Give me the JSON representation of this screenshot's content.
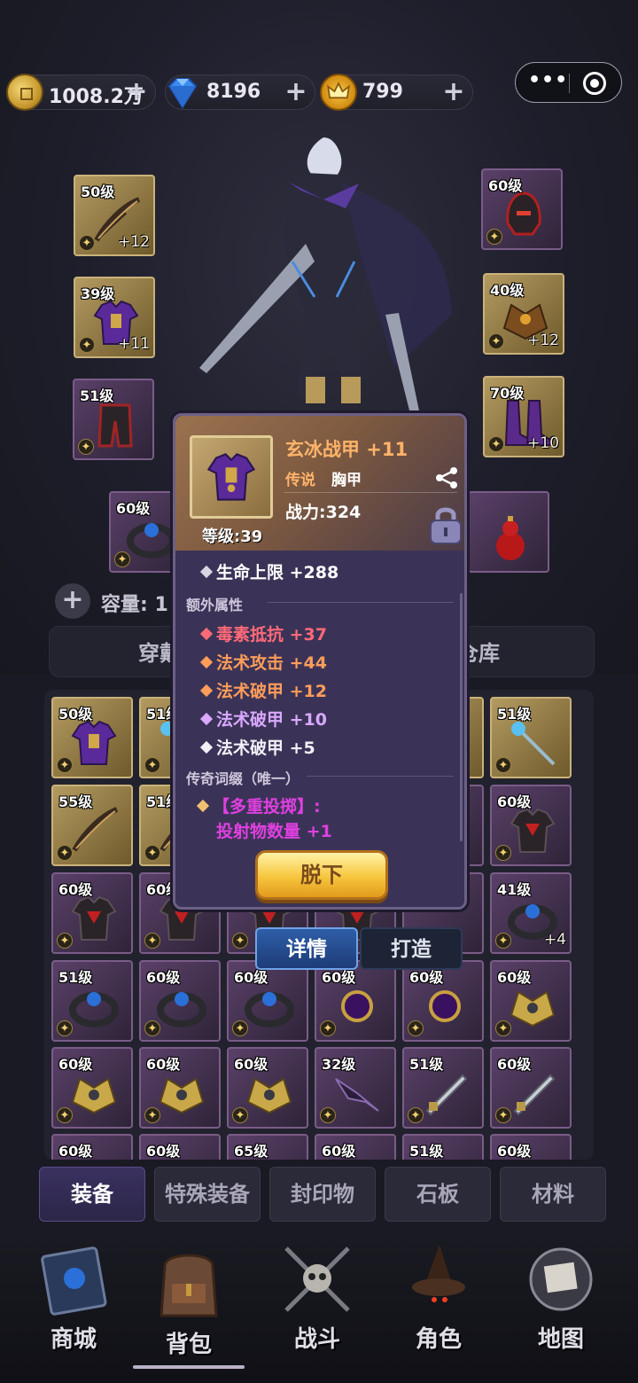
{
  "currency": {
    "gold": "1008.2万",
    "diamonds": "8196",
    "crowns": "799",
    "plus_symbol": "+"
  },
  "capsule": {
    "more_label": "•••"
  },
  "equipped_slots": [
    {
      "level": "50级",
      "enhance": "+12",
      "frame": "gold",
      "item": "bow"
    },
    {
      "level": "39级",
      "enhance": "+11",
      "frame": "gold",
      "item": "chest-armor"
    },
    {
      "level": "51级",
      "enhance": "",
      "frame": "purple",
      "item": "pants"
    },
    {
      "level": "60级",
      "enhance": "",
      "frame": "purple",
      "item": "ring"
    },
    {
      "level": "60级",
      "enhance": "",
      "frame": "purple",
      "item": "helmet"
    },
    {
      "level": "40级",
      "enhance": "+12",
      "frame": "gold",
      "item": "shoulder"
    },
    {
      "level": "70级",
      "enhance": "+10",
      "frame": "gold",
      "item": "boots"
    },
    {
      "level": "",
      "enhance": "",
      "frame": "purple",
      "item": "gourd"
    }
  ],
  "capacity": {
    "label": "容量: 11"
  },
  "subtabs": {
    "left": "穿戴",
    "right": "仓库"
  },
  "inventory": [
    {
      "level": "50级",
      "enhance": "",
      "frame": "gold",
      "item": "chest-armor"
    },
    {
      "level": "51级",
      "enhance": "",
      "frame": "gold",
      "item": "staff"
    },
    {
      "level": "",
      "enhance": "",
      "frame": "gold",
      "item": "none"
    },
    {
      "level": "",
      "enhance": "",
      "frame": "gold",
      "item": "none"
    },
    {
      "level": "",
      "enhance": "",
      "frame": "gold",
      "item": "none"
    },
    {
      "level": "51级",
      "enhance": "",
      "frame": "gold",
      "item": "staff"
    },
    {
      "level": "55级",
      "enhance": "",
      "frame": "gold",
      "item": "bow"
    },
    {
      "level": "51级",
      "enhance": "",
      "frame": "gold",
      "item": "bow"
    },
    {
      "level": "",
      "enhance": "",
      "frame": "purple",
      "item": "none"
    },
    {
      "level": "",
      "enhance": "",
      "frame": "purple",
      "item": "none"
    },
    {
      "level": "",
      "enhance": "",
      "frame": "purple",
      "item": "none"
    },
    {
      "level": "60级",
      "enhance": "",
      "frame": "purple",
      "item": "chest-red"
    },
    {
      "level": "60级",
      "enhance": "",
      "frame": "purple",
      "item": "chest-red"
    },
    {
      "level": "60级",
      "enhance": "",
      "frame": "purple",
      "item": "chest-red"
    },
    {
      "level": "",
      "enhance": "",
      "frame": "purple",
      "item": "chest-red"
    },
    {
      "level": "",
      "enhance": "",
      "frame": "purple",
      "item": "chest-red"
    },
    {
      "level": "",
      "enhance": "",
      "frame": "purple",
      "item": "none"
    },
    {
      "level": "41级",
      "enhance": "+4",
      "frame": "purple",
      "item": "ring"
    },
    {
      "level": "51级",
      "enhance": "",
      "frame": "purple",
      "item": "ring"
    },
    {
      "level": "60级",
      "enhance": "",
      "frame": "purple",
      "item": "ring"
    },
    {
      "level": "60级",
      "enhance": "",
      "frame": "purple",
      "item": "ring"
    },
    {
      "level": "60级",
      "enhance": "",
      "frame": "purple",
      "item": "amulet"
    },
    {
      "level": "60级",
      "enhance": "",
      "frame": "purple",
      "item": "amulet"
    },
    {
      "level": "60级",
      "enhance": "",
      "frame": "purple",
      "item": "shoulder-gold"
    },
    {
      "level": "60级",
      "enhance": "",
      "frame": "purple",
      "item": "shoulder-gold"
    },
    {
      "level": "60级",
      "enhance": "",
      "frame": "purple",
      "item": "shoulder-gold"
    },
    {
      "level": "60级",
      "enhance": "",
      "frame": "purple",
      "item": "shoulder-gold"
    },
    {
      "level": "32级",
      "enhance": "",
      "frame": "purple",
      "item": "wings"
    },
    {
      "level": "51级",
      "enhance": "",
      "frame": "purple",
      "item": "blade"
    },
    {
      "level": "60级",
      "enhance": "",
      "frame": "purple",
      "item": "blade"
    },
    {
      "level": "60级",
      "enhance": "",
      "frame": "purple",
      "item": "blade"
    },
    {
      "level": "60级",
      "enhance": "",
      "frame": "purple",
      "item": "blade"
    },
    {
      "level": "65级",
      "enhance": "",
      "frame": "purple",
      "item": "blade"
    },
    {
      "level": "60级",
      "enhance": "",
      "frame": "purple",
      "item": "blade"
    },
    {
      "level": "51级",
      "enhance": "",
      "frame": "purple",
      "item": "blade"
    },
    {
      "level": "60级",
      "enhance": "",
      "frame": "purple",
      "item": "blade"
    }
  ],
  "popup": {
    "name": "玄冰战甲 +11",
    "rarity": "传说",
    "slot_type": "胸甲",
    "power": "战力:324",
    "level": "等级:39",
    "base_stat": "生命上限 +288",
    "extra_title": "额外属性",
    "extra_stats": [
      {
        "text": "毒素抵抗 +37",
        "color": "#ff6a78"
      },
      {
        "text": "法术攻击 +44",
        "color": "#ff9d5a"
      },
      {
        "text": "法术破甲 +12",
        "color": "#ff9d5a"
      },
      {
        "text": "法术破甲 +10",
        "color": "#d9a8ff"
      },
      {
        "text": "法术破甲 +5",
        "color": "#f2f0f6"
      }
    ],
    "legend_title": "传奇词缀（唯一）",
    "legend_line1": "【多重投掷】:",
    "legend_line2": "投射物数量 +1",
    "unequip_button": "脱下"
  },
  "detail_tabs": {
    "details": "详情",
    "forge": "打造"
  },
  "categories": [
    "装备",
    "特殊装备",
    "封印物",
    "石板",
    "材料"
  ],
  "nav": [
    "商城",
    "背包",
    "战斗",
    "角色",
    "地图"
  ]
}
